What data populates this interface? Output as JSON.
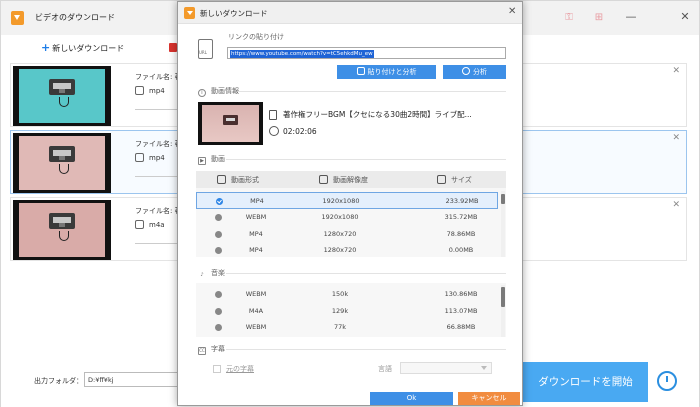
{
  "main": {
    "title": "ビデオのダウンロード",
    "new_download_label": "新しいダウンロード",
    "items": [
      {
        "file_name": "ファイル名: 著作",
        "format": "mp4",
        "thumb_color": "#58c7c9"
      },
      {
        "file_name": "ファイル名: 著作",
        "format": "mp4",
        "thumb_color": "#e0b9b6"
      },
      {
        "file_name": "ファイル名: 著作",
        "format": "m4a",
        "thumb_color": "#d9aba8"
      }
    ],
    "output_folder_label": "出力フォルダ：",
    "output_folder_value": "D:¥ff¥kj",
    "start_button": "ダウンロードを開始"
  },
  "dialog": {
    "title": "新しいダウンロード",
    "link_label": "リンクの貼り付け",
    "url": "https://www.youtube.com/watch?v=tC5ehkdMu_ew",
    "paste_analyze_button": "貼り付けと分析",
    "analyze_button": "分析",
    "video_info_label": "動画情報",
    "video_title": "著作権フリーBGM【クセになる30曲2時間】ライブ配...",
    "duration": "02:02:06",
    "video_section_label": "動画",
    "video_table": {
      "headers": [
        "動画形式",
        "動画解像度",
        "サイズ"
      ],
      "rows": [
        {
          "format": "MP4",
          "resolution": "1920x1080",
          "size": "233.92MB",
          "selected": true
        },
        {
          "format": "WEBM",
          "resolution": "1920x1080",
          "size": "315.72MB",
          "selected": false
        },
        {
          "format": "MP4",
          "resolution": "1280x720",
          "size": "78.86MB",
          "selected": false
        },
        {
          "format": "MP4",
          "resolution": "1280x720",
          "size": "0.00MB",
          "selected": false
        }
      ]
    },
    "audio_section_label": "音楽",
    "audio_table": {
      "rows": [
        {
          "format": "WEBM",
          "bitrate": "150k",
          "size": "130.86MB"
        },
        {
          "format": "M4A",
          "bitrate": "129k",
          "size": "113.07MB"
        },
        {
          "format": "WEBM",
          "bitrate": "77k",
          "size": "66.88MB"
        }
      ]
    },
    "subtitle_section_label": "字幕",
    "original_subtitle_label": "元の字幕",
    "language_label": "言語",
    "ok_button": "Ok",
    "cancel_button": "キャンセル"
  },
  "colors": {
    "accent_blue": "#3e8fe6",
    "start_button_blue": "#49a9f2",
    "cancel_orange": "#f18c40",
    "app_icon_orange": "#f39a2b"
  }
}
